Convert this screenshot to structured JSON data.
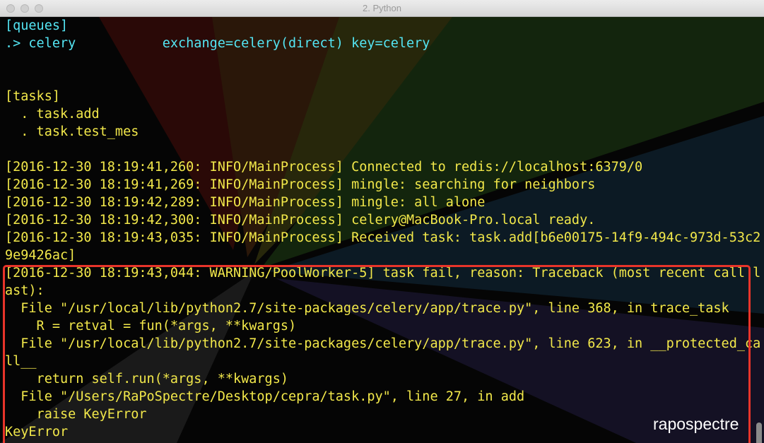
{
  "window": {
    "title": "2. Python"
  },
  "terminal": {
    "lines": [
      {
        "text": "[queues]",
        "color": "cyan"
      },
      {
        "text": ".> celery           exchange=celery(direct) key=celery",
        "color": "cyan"
      },
      {
        "text": "",
        "color": "cyan"
      },
      {
        "text": "",
        "color": "cyan"
      },
      {
        "text": "[tasks]",
        "color": "yellow"
      },
      {
        "text": "  . task.add",
        "color": "yellow"
      },
      {
        "text": "  . task.test_mes",
        "color": "yellow"
      },
      {
        "text": "",
        "color": "yellow"
      },
      {
        "text": "[2016-12-30 18:19:41,260: INFO/MainProcess] Connected to redis://localhost:6379/0",
        "color": "yellow"
      },
      {
        "text": "[2016-12-30 18:19:41,269: INFO/MainProcess] mingle: searching for neighbors",
        "color": "yellow"
      },
      {
        "text": "[2016-12-30 18:19:42,289: INFO/MainProcess] mingle: all alone",
        "color": "yellow"
      },
      {
        "text": "[2016-12-30 18:19:42,300: INFO/MainProcess] celery@MacBook-Pro.local ready.",
        "color": "yellow"
      },
      {
        "text": "[2016-12-30 18:19:43,035: INFO/MainProcess] Received task: task.add[b6e00175-14f9-494c-973d-53c2",
        "color": "yellow"
      },
      {
        "text": "9e9426ac]",
        "color": "yellow"
      },
      {
        "text": "[2016-12-30 18:19:43,044: WARNING/PoolWorker-5] task fail, reason: Traceback (most recent call l",
        "color": "yellow"
      },
      {
        "text": "ast):",
        "color": "yellow"
      },
      {
        "text": "  File \"/usr/local/lib/python2.7/site-packages/celery/app/trace.py\", line 368, in trace_task",
        "color": "yellow"
      },
      {
        "text": "    R = retval = fun(*args, **kwargs)",
        "color": "yellow"
      },
      {
        "text": "  File \"/usr/local/lib/python2.7/site-packages/celery/app/trace.py\", line 623, in __protected_ca",
        "color": "yellow"
      },
      {
        "text": "ll__",
        "color": "yellow"
      },
      {
        "text": "    return self.run(*args, **kwargs)",
        "color": "yellow"
      },
      {
        "text": "  File \"/Users/RaPoSpectre/Desktop/cepra/task.py\", line 27, in add",
        "color": "yellow"
      },
      {
        "text": "    raise KeyError",
        "color": "yellow"
      },
      {
        "text": "KeyError",
        "color": "yellow"
      }
    ]
  },
  "watermark": "rapospectre",
  "colors": {
    "cyan": "#54e6f4",
    "yellow": "#f2e84a",
    "highlight": "#e8342a"
  }
}
